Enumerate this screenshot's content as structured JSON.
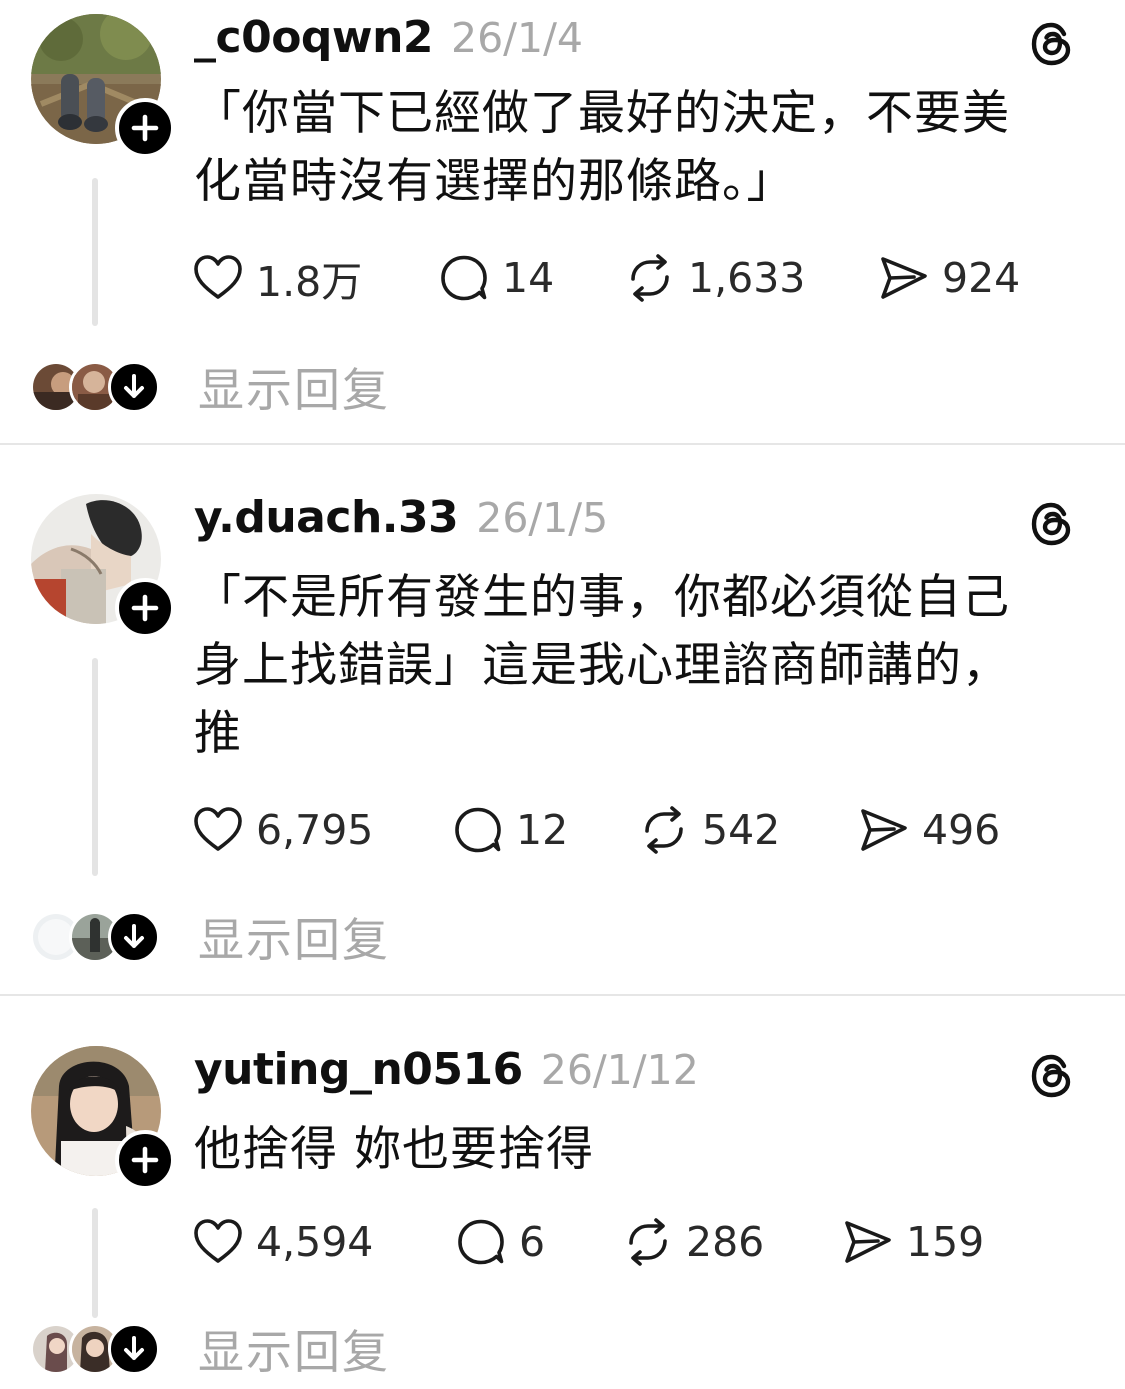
{
  "posts": [
    {
      "username": "_c0oqwn2",
      "date": "26/1/4",
      "content_lines": [
        "「你當下已經做了最好的決定，不要美",
        "化當時沒有選擇的那條路。」"
      ],
      "likes": "1.8万",
      "comments": "14",
      "reposts": "1,633",
      "shares": "924",
      "show_replies": "显示回复"
    },
    {
      "username": "y.duach.33",
      "date": "26/1/5",
      "content_lines": [
        "「不是所有發生的事，你都必須從自己",
        "身上找錯誤」這是我心理諮商師講的，",
        "推"
      ],
      "likes": "6,795",
      "comments": "12",
      "reposts": "542",
      "shares": "496",
      "show_replies": "显示回复"
    },
    {
      "username": "yuting_n0516",
      "date": "26/1/12",
      "content_lines": [
        "他捨得 妳也要捨得"
      ],
      "likes": "4,594",
      "comments": "6",
      "reposts": "286",
      "shares": "159",
      "show_replies": "显示回复"
    }
  ],
  "icons": {
    "like": "heart-icon",
    "comment": "comment-bubble-icon",
    "repost": "repost-icon",
    "share": "send-icon",
    "brand": "threads-logo-icon",
    "follow": "plus-icon",
    "expand": "arrow-down-icon"
  },
  "colors": {
    "text": "#101010",
    "muted": "#a8a8a8",
    "divider": "#e6e6e6",
    "thread_line": "#e4e4e4"
  }
}
